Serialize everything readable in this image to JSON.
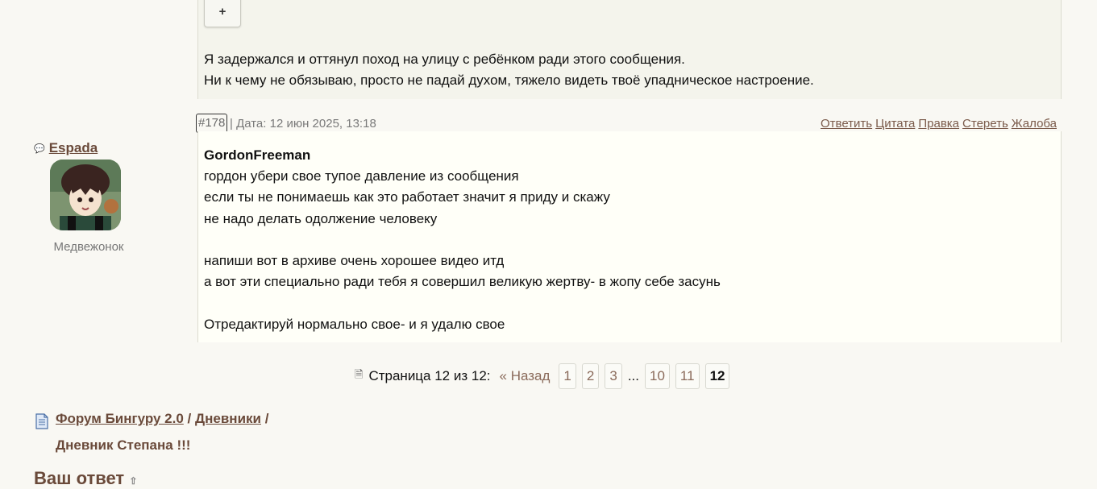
{
  "prev_post": {
    "plus_label": "+",
    "lines": [
      "Я задержался и оттянул поход на улицу с ребёнком ради этого сообщения.",
      "Ни к чему не обязываю, просто не падай духом, тяжело видеть твоё упадническое настроение."
    ]
  },
  "post": {
    "number": "#178",
    "date": "| Дата: 12 июн 2025, 13:18",
    "actions": [
      "Ответить",
      "Цитата",
      "Правка",
      "Стереть",
      "Жалоба"
    ],
    "quote_author": "GordonFreeman",
    "lines": [
      "гордон убери свое тупое давление из сообщения",
      "если ты не понимаешь как это работает значит я приду и скажу",
      "не надо делать одолжение человеку",
      "",
      "напиши вот в архиве очень хорошее видео итд",
      "а вот эти специально ради тебя я совершил великую жертву- в жопу себе засунь",
      "",
      "Отредактируй нормально свое- и я удалю свое"
    ]
  },
  "user": {
    "name": "Espada",
    "rank": "Медвежонок",
    "chat_icon": "chat-bubble-icon"
  },
  "pagination": {
    "label": "Страница 12 из 12:",
    "back": "« Назад",
    "pages": [
      "1",
      "2",
      "3"
    ],
    "ellipsis": "...",
    "pages_end": [
      "10",
      "11"
    ],
    "current": "12"
  },
  "breadcrumb": {
    "forum": "Форум Бингуру 2.0",
    "separator": "/",
    "section": "Дневники",
    "topic": "Дневник Степана !!!"
  },
  "reply": {
    "heading": "Ваш ответ",
    "arrow": "⇧"
  },
  "colors": {
    "link": "#6a4a3a",
    "post_bg": "#fffff8",
    "prev_post_bg": "#f4f4ec",
    "page_bg": "#f9f8f3"
  }
}
